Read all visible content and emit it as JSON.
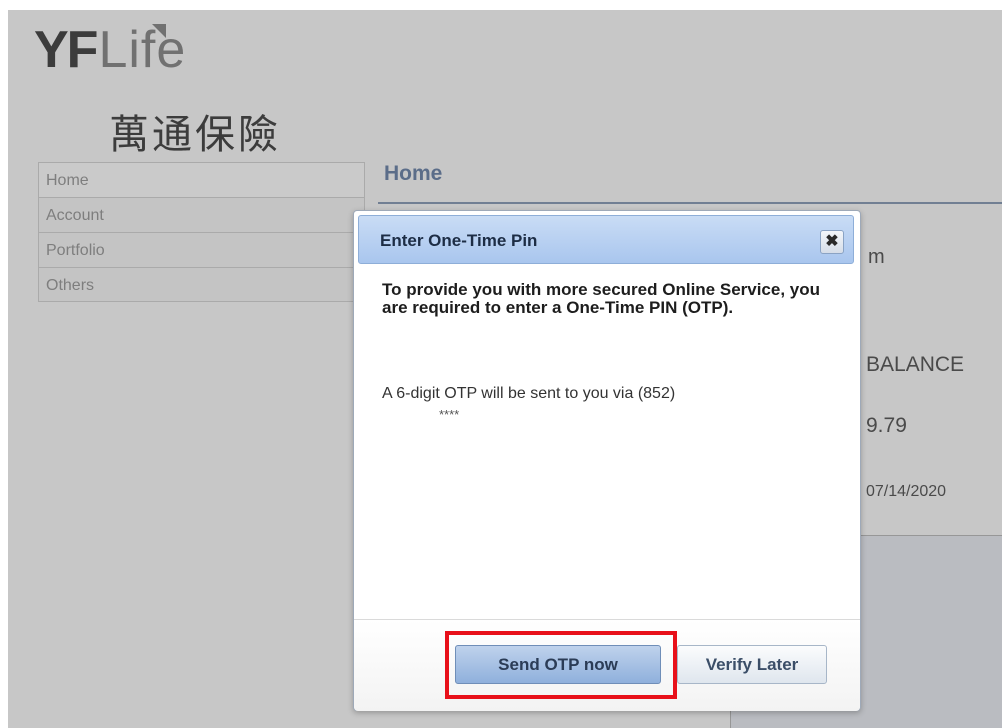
{
  "brand": {
    "logo_primary": "YF",
    "logo_secondary": "Life",
    "logo_chinese": "萬通保險"
  },
  "sidebar": {
    "items": [
      {
        "label": "Home"
      },
      {
        "label": "Account"
      },
      {
        "label": "Portfolio"
      },
      {
        "label": "Others"
      }
    ]
  },
  "main": {
    "title": "Home",
    "bg_fragment_m": "m",
    "bg_balance_label": "BALANCE",
    "bg_amount": "9.79",
    "bg_date": "07/14/2020"
  },
  "dialog": {
    "title": "Enter One-Time Pin",
    "close_icon": "close-icon",
    "message": "To provide you with more secured Online Service, you are required to enter a One-Time PIN (OTP).",
    "info": "A 6-digit OTP will be sent to you via (852)",
    "phone_mask": "****",
    "send_button": "Send OTP now",
    "later_button": "Verify Later"
  },
  "colors": {
    "header_gradient_top": "#c9dcf5",
    "header_gradient_bottom": "#a9c6ee",
    "highlight_border": "#e8101a",
    "title_color": "#6f85a8"
  }
}
